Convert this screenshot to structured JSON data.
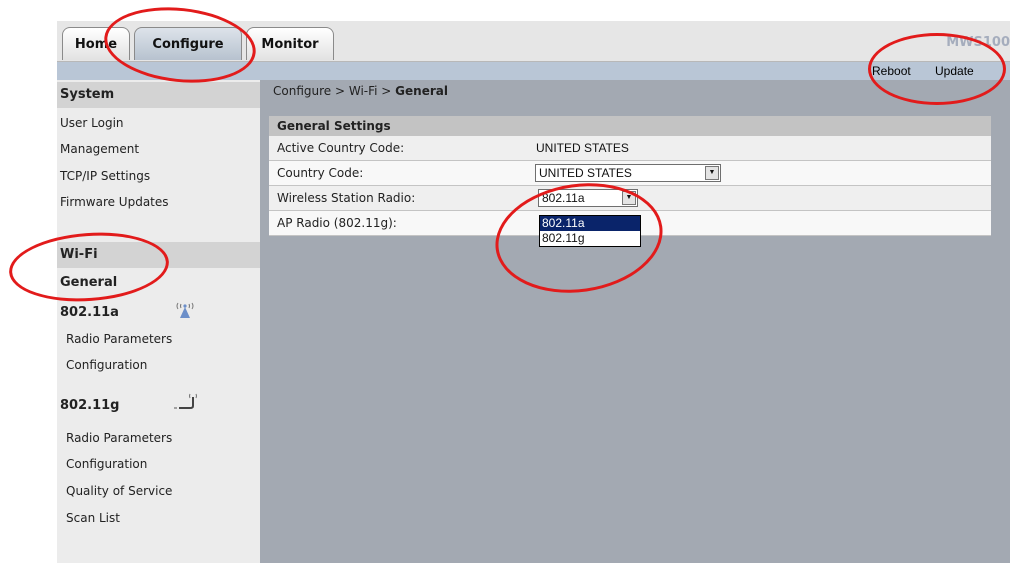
{
  "tabs": [
    {
      "label": "Home"
    },
    {
      "label": "Configure"
    },
    {
      "label": "Monitor"
    }
  ],
  "model": "MWS100",
  "actions": {
    "reboot": "Reboot",
    "update": "Update"
  },
  "sidebar": {
    "system": {
      "heading": "System",
      "items": [
        "User Login",
        "Management",
        "TCP/IP Settings",
        "Firmware Updates"
      ]
    },
    "wifi": {
      "heading": "Wi-Fi",
      "general": "General",
      "a": {
        "title": "802.11a",
        "items": [
          "Radio Parameters",
          "Configuration"
        ]
      },
      "g": {
        "title": "802.11g",
        "items": [
          "Radio Parameters",
          "Configuration",
          "Quality of Service",
          "Scan List"
        ]
      }
    }
  },
  "breadcrumb": {
    "trail": "Configure > Wi-Fi > ",
    "current": "General"
  },
  "panel": {
    "title": "General Settings",
    "rows": [
      {
        "label": "Active Country Code:",
        "value": "UNITED STATES"
      },
      {
        "label": "Country Code:",
        "value": "UNITED STATES"
      },
      {
        "label": "Wireless Station Radio:",
        "value": "802.11a"
      },
      {
        "label": "AP Radio (802.11g):"
      }
    ]
  },
  "dropdown": {
    "options": [
      "802.11a",
      "802.11g"
    ],
    "selected": "802.11a"
  },
  "colors": {
    "highlight": "#e21b1b",
    "selection": "#0a246a",
    "content_bg": "#a3a9b2"
  }
}
